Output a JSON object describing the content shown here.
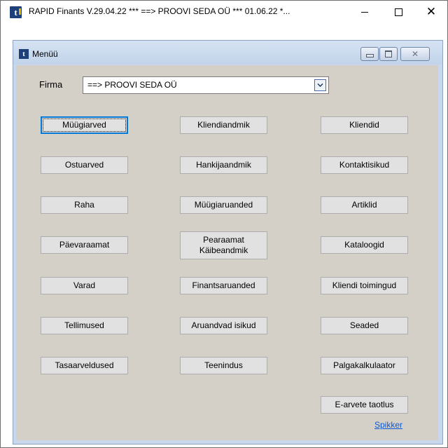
{
  "window": {
    "title": "RAPID Finants V.29.04.22 ***  ==> PROOVI SEDA OÜ  ***  01.06.22  *...",
    "controls": {
      "minimize": "—",
      "maximize": "☐",
      "close": "✕"
    }
  },
  "menu_window": {
    "title": "Menüü"
  },
  "firma": {
    "label": "Firma",
    "value": "==> PROOVI SEDA OÜ"
  },
  "buttons": {
    "muugiarved": "Müügiarved",
    "ostuarved": "Ostuarved",
    "raha": "Raha",
    "paevaraamat": "Päevaraamat",
    "varad": "Varad",
    "tellimused": "Tellimused",
    "tasaarveldused": "Tasaarveldused",
    "kliendiandmik": "Kliendiandmik",
    "hankijaandmik": "Hankijaandmik",
    "muugiaruanded": "Müügiaruanded",
    "pearaamat_line1": "Pearaamat",
    "pearaamat_line2": "Käibeandmik",
    "finantsaruanded": "Finantsaruanded",
    "aruandvad_isikud": "Aruandvad isikud",
    "teenindus": "Teenindus",
    "kliendid": "Kliendid",
    "kontaktisikud": "Kontaktisikud",
    "artiklid": "Artiklid",
    "kataloogid": "Kataloogid",
    "kliendi_toimingud": "Kliendi toimingud",
    "seaded": "Seaded",
    "palgakalkulaator": "Palgakalkulaator",
    "e_arvete_taotlus": "E-arvete taotlus"
  },
  "help_link": "Spikker"
}
